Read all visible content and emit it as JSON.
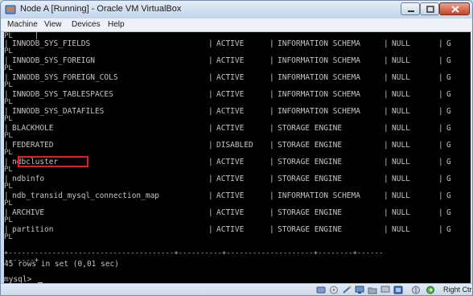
{
  "window": {
    "title": "Node A [Running] - Oracle VM VirtualBox"
  },
  "menu": {
    "items": [
      "Machine",
      "View",
      "Devices",
      "Help"
    ]
  },
  "console": {
    "top_fragment": "PL",
    "separator_tail": "PL",
    "rows": [
      {
        "name": "INNODB_SYS_FIELDS",
        "status": "ACTIVE",
        "type": "INFORMATION SCHEMA",
        "library": "NULL",
        "license": "G"
      },
      {
        "name": "INNODB_SYS_FOREIGN",
        "status": "ACTIVE",
        "type": "INFORMATION SCHEMA",
        "library": "NULL",
        "license": "G"
      },
      {
        "name": "INNODB_SYS_FOREIGN_COLS",
        "status": "ACTIVE",
        "type": "INFORMATION SCHEMA",
        "library": "NULL",
        "license": "G"
      },
      {
        "name": "INNODB_SYS_TABLESPACES",
        "status": "ACTIVE",
        "type": "INFORMATION SCHEMA",
        "library": "NULL",
        "license": "G"
      },
      {
        "name": "INNODB_SYS_DATAFILES",
        "status": "ACTIVE",
        "type": "INFORMATION SCHEMA",
        "library": "NULL",
        "license": "G"
      },
      {
        "name": "BLACKHOLE",
        "status": "ACTIVE",
        "type": "STORAGE ENGINE",
        "library": "NULL",
        "license": "G"
      },
      {
        "name": "FEDERATED",
        "status": "DISABLED",
        "type": "STORAGE ENGINE",
        "library": "NULL",
        "license": "G"
      },
      {
        "name": "ndbcluster",
        "status": "ACTIVE",
        "type": "STORAGE ENGINE",
        "library": "NULL",
        "license": "G"
      },
      {
        "name": "ndbinfo",
        "status": "ACTIVE",
        "type": "STORAGE ENGINE",
        "library": "NULL",
        "license": "G"
      },
      {
        "name": "ndb_transid_mysql_connection_map",
        "status": "ACTIVE",
        "type": "INFORMATION SCHEMA",
        "library": "NULL",
        "license": "G"
      },
      {
        "name": "ARCHIVE",
        "status": "ACTIVE",
        "type": "STORAGE ENGINE",
        "library": "NULL",
        "license": "G"
      },
      {
        "name": "partition",
        "status": "ACTIVE",
        "type": "STORAGE ENGINE",
        "library": "NULL",
        "license": "G"
      }
    ],
    "bottom_border": "+--------------------------------------+----------+--------------------+--------+------",
    "bottom_border_tail": "-------+",
    "result_text": "45 rows in set (0,01 sec)",
    "prompt": "mysql> "
  },
  "statusbar": {
    "host_key": "Right Ctrl"
  }
}
